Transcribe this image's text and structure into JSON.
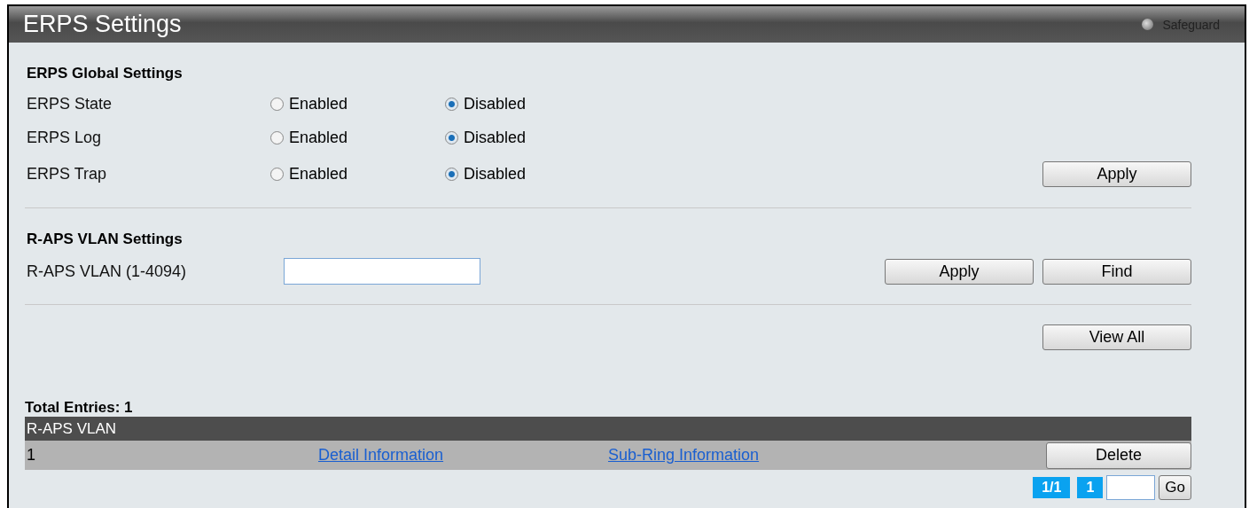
{
  "window": {
    "title": "ERPS Settings",
    "safeguard": "Safeguard"
  },
  "global_settings": {
    "title": "ERPS Global Settings",
    "rows": [
      {
        "label": "ERPS State",
        "options": [
          {
            "label": "Enabled",
            "selected": false
          },
          {
            "label": "Disabled",
            "selected": true
          }
        ]
      },
      {
        "label": "ERPS Log",
        "options": [
          {
            "label": "Enabled",
            "selected": false
          },
          {
            "label": "Disabled",
            "selected": true
          }
        ]
      },
      {
        "label": "ERPS Trap",
        "options": [
          {
            "label": "Enabled",
            "selected": false
          },
          {
            "label": "Disabled",
            "selected": true
          }
        ]
      }
    ],
    "apply_button": "Apply"
  },
  "raps_settings": {
    "title": "R-APS VLAN Settings",
    "field_label": "R-APS VLAN (1-4094)",
    "apply_button": "Apply",
    "find_button": "Find"
  },
  "view_all_button": "View All",
  "total_entries": "Total Entries: 1",
  "table": {
    "columns": [
      "R-APS VLAN"
    ],
    "rows": [
      {
        "vlan": "1",
        "detail_link": "Detail Information",
        "subring_link": "Sub-Ring Information",
        "delete_button": "Delete"
      }
    ]
  },
  "pagination": {
    "page_of": "1/1",
    "pages": [
      "1"
    ],
    "go_button": "Go"
  }
}
